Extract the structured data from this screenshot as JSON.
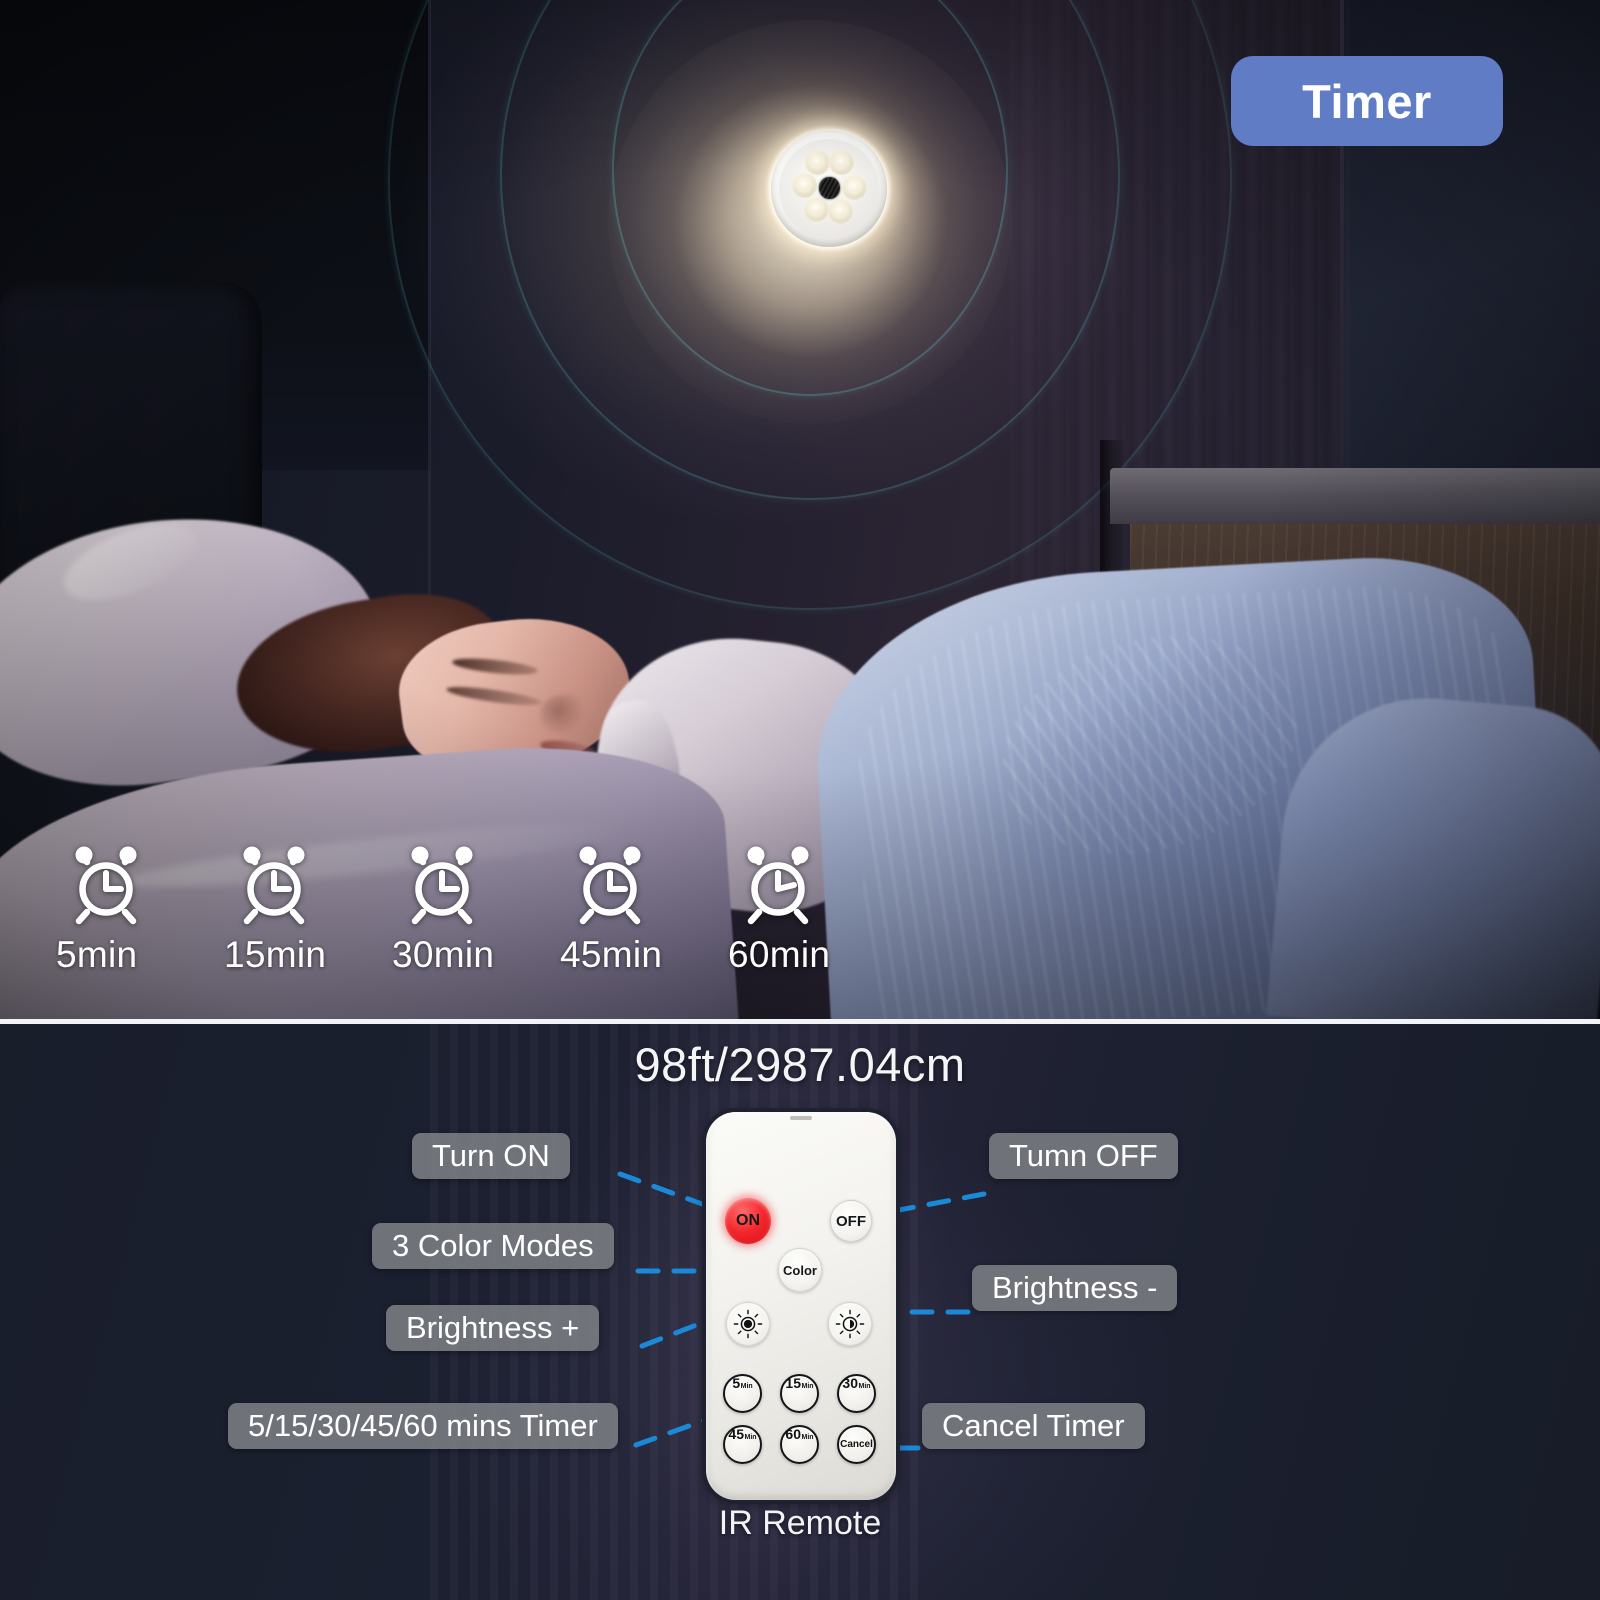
{
  "badge": {
    "label": "Timer"
  },
  "scene": {
    "name": "bedroom-night-scene",
    "description": "Person sleeping in bed under a knit blanket with a ceiling puck light glowing above",
    "light_fixture": {
      "name": "led-puck-light",
      "led_count": 6,
      "sensor": "ir-sensor"
    },
    "signal_rings": 3,
    "colors": {
      "badge_bg": "#5f7cc5",
      "wall_dark": "#141820",
      "panel_bg": "#1b2030",
      "divider": "#f2f3f5",
      "connector": "#1a8ad8",
      "pill_bg": "#7e8086",
      "on_button": "#f4262c",
      "glow_warm": "#fff0cd"
    }
  },
  "timers": [
    {
      "icon": "alarm-clock-icon",
      "label": "5min"
    },
    {
      "icon": "alarm-clock-icon",
      "label": "15min"
    },
    {
      "icon": "alarm-clock-icon",
      "label": "30min"
    },
    {
      "icon": "alarm-clock-icon",
      "label": "45min"
    },
    {
      "icon": "alarm-clock-icon",
      "label": "60min"
    }
  ],
  "range": {
    "title": "98ft/2987.04cm"
  },
  "remote": {
    "caption": "IR Remote",
    "buttons": {
      "on": "ON",
      "off": "OFF",
      "color": "Color",
      "brightness_up_icon": "brightness-high-icon",
      "brightness_down_icon": "brightness-low-icon"
    },
    "timer_buttons": [
      {
        "num": "5",
        "unit": "Min"
      },
      {
        "num": "15",
        "unit": "Min"
      },
      {
        "num": "30",
        "unit": "Min"
      },
      {
        "num": "45",
        "unit": "Min"
      },
      {
        "num": "60",
        "unit": "Min"
      },
      {
        "num": "Cancel",
        "unit": ""
      }
    ]
  },
  "callouts": {
    "turn_on": "Turn ON",
    "color_modes": "3 Color Modes",
    "brightness_up": "Brightness +",
    "timer_presets": "5/15/30/45/60 mins Timer",
    "turn_off": "Tumn OFF",
    "brightness_down": "Brightness -",
    "cancel_timer": "Cancel Timer"
  }
}
